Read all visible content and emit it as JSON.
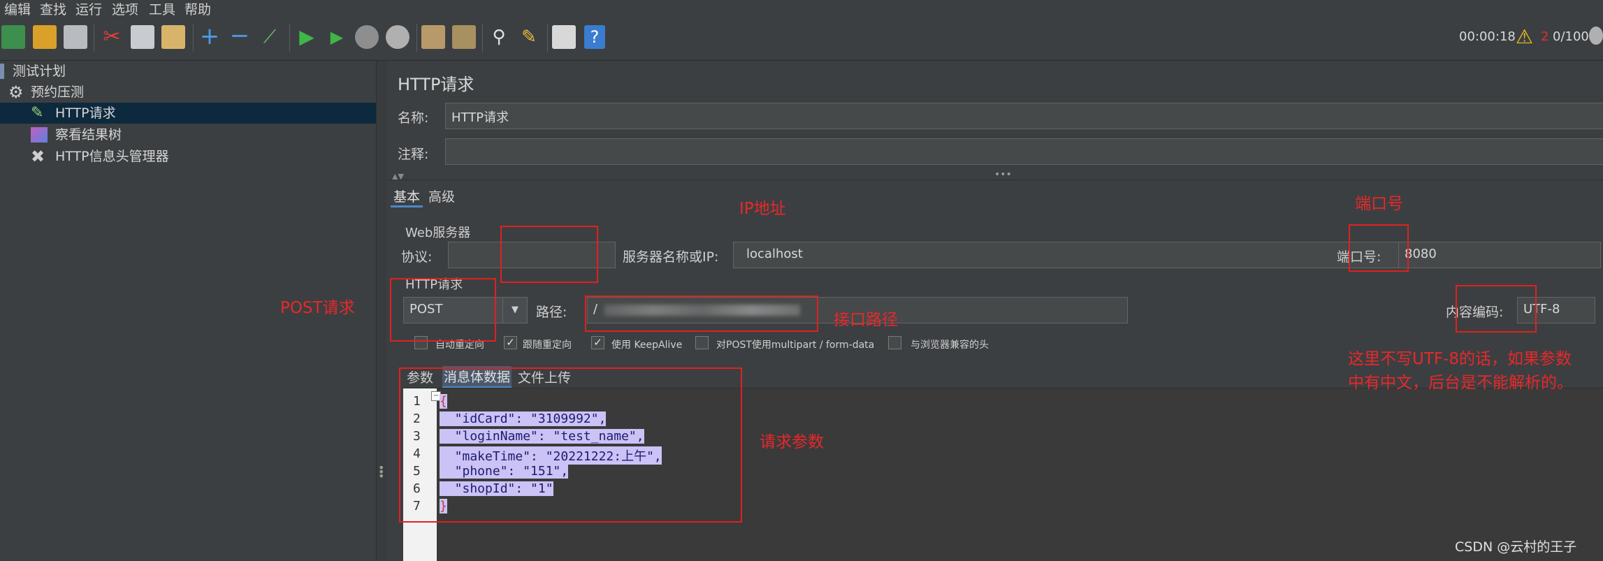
{
  "menu": [
    "编辑",
    "查找",
    "运行",
    "选项",
    "工具",
    "帮助"
  ],
  "toolbar": {
    "icons": [
      "templates-icon",
      "open-icon",
      "save-icon",
      "cut-icon",
      "copy-icon",
      "paste-icon",
      "expand-icon",
      "collapse-icon",
      "toggle-icon",
      "start-icon",
      "start-no-pause-icon",
      "stop-icon",
      "shutdown-icon",
      "clear-icon",
      "clear-all-icon",
      "search-icon",
      "reset-search-icon",
      "function-helper-icon",
      "help-icon"
    ],
    "timer": "00:00:18",
    "warning_count": "2",
    "threads": "0/100"
  },
  "tree": {
    "items": [
      {
        "label": "测试计划"
      },
      {
        "label": "预约压测"
      },
      {
        "label": "HTTP请求"
      },
      {
        "label": "察看结果树"
      },
      {
        "label": "HTTP信息头管理器"
      }
    ]
  },
  "panel": {
    "title": "HTTP请求",
    "name_label": "名称:",
    "name_value": "HTTP请求",
    "comment_label": "注释:",
    "comment_value": "",
    "tabs": [
      "基本",
      "高级"
    ],
    "web_server_label": "Web服务器",
    "protocol_label": "协议:",
    "protocol_value": "",
    "server_label": "服务器名称或IP:",
    "server_value": "localhost",
    "port_label": "端口号:",
    "port_value": "8080",
    "http_request_label": "HTTP请求",
    "method_value": "POST",
    "path_label": "路径:",
    "path_value": "/",
    "encoding_label": "内容编码:",
    "encoding_value": "UTF-8",
    "checkboxes": [
      {
        "label": "自动重定向",
        "checked": false
      },
      {
        "label": "跟随重定向",
        "checked": true
      },
      {
        "label": "使用 KeepAlive",
        "checked": true
      },
      {
        "label": "对POST使用multipart / form-data",
        "checked": false
      },
      {
        "label": "与浏览器兼容的头",
        "checked": false
      }
    ],
    "body_tabs": [
      "参数",
      "消息体数据",
      "文件上传"
    ],
    "code_lines": [
      {
        "num": "1",
        "text": "{"
      },
      {
        "num": "2",
        "text": "  \"idCard\": \"3109992\","
      },
      {
        "num": "3",
        "text": "  \"loginName\": \"test_name\","
      },
      {
        "num": "4",
        "text": "  \"makeTime\": \"20221222:上午\","
      },
      {
        "num": "5",
        "text": "  \"phone\": \"151\","
      },
      {
        "num": "6",
        "text": "  \"shopId\": \"1\""
      },
      {
        "num": "7",
        "text": "}"
      }
    ]
  },
  "annotations": {
    "ip": "IP地址",
    "port": "端口号",
    "post": "POST请求",
    "path": "接口路径",
    "params": "请求参数",
    "utf8_line1": "这里不写UTF-8的话，如果参数",
    "utf8_line2": "中有中文，后台是不能解析的。"
  },
  "watermark": "CSDN @云村的王子",
  "colors": {
    "annotation": "#e02020",
    "selection": "#0d293e",
    "code_highlight": "#cbc2f5"
  }
}
